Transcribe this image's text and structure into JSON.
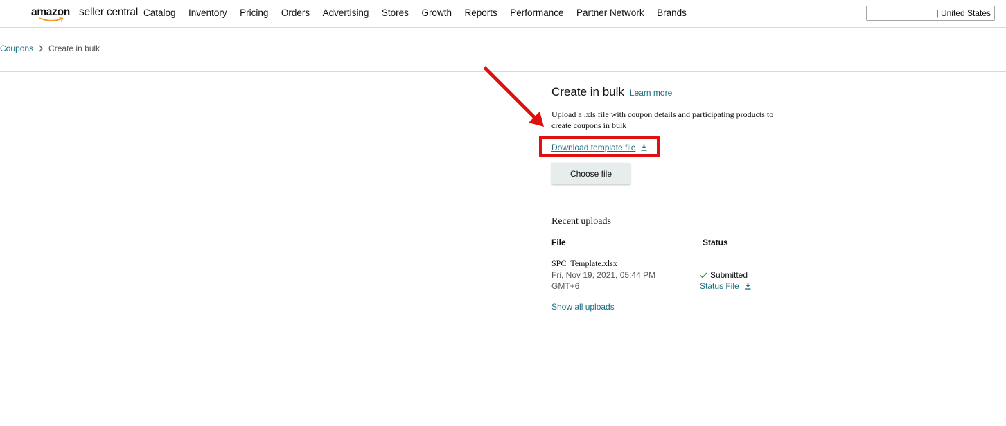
{
  "brand": {
    "word1": "amazon",
    "word2": "seller central"
  },
  "nav": {
    "items": [
      "Catalog",
      "Inventory",
      "Pricing",
      "Orders",
      "Advertising",
      "Stores",
      "Growth",
      "Reports",
      "Performance",
      "Partner Network",
      "Brands"
    ],
    "region": "| United States"
  },
  "breadcrumb": {
    "parent": "Coupons",
    "current": "Create in bulk"
  },
  "main": {
    "title": "Create in bulk",
    "learn_more": "Learn more",
    "description": "Upload a .xls file with coupon details and participating products to create coupons in bulk",
    "download_label": "Download template file",
    "choose_file_label": "Choose file",
    "recent_title": "Recent uploads",
    "col_file": "File",
    "col_status": "Status",
    "upload": {
      "file_name": "SPC_Template.xlsx",
      "date": "Fri, Nov 19, 2021, 05:44 PM GMT+6",
      "status": "Submitted",
      "status_file_label": "Status File"
    },
    "show_all_label": "Show all uploads"
  },
  "colors": {
    "link": "#1a6e7f",
    "highlight": "#e01010",
    "button_bg": "#e7ecec",
    "check": "#3a8a2a",
    "logo_smile": "#f29b1f"
  },
  "icons": {
    "download": "download-icon",
    "check": "check-icon",
    "breadcrumb_separator": "chevron-right-icon",
    "annotation": "red-arrow-annotation"
  }
}
